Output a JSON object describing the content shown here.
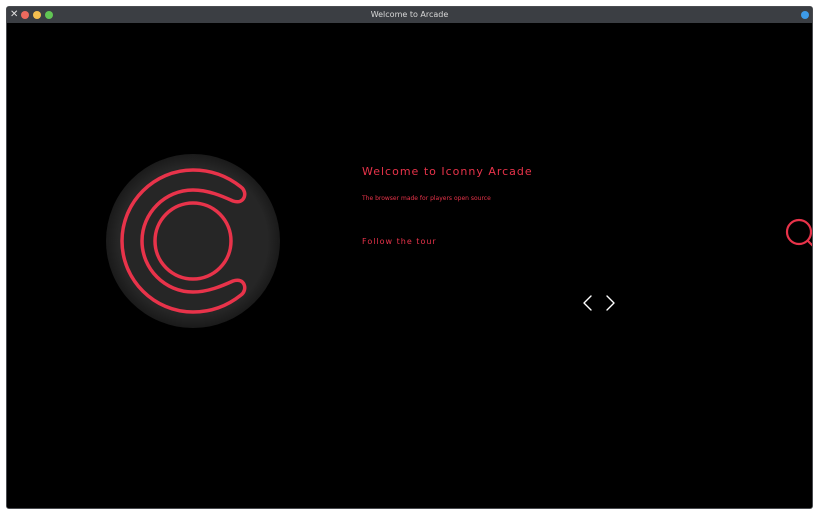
{
  "window": {
    "title": "Welcome to Arcade",
    "close_glyph": "✕"
  },
  "hero": {
    "title": "Welcome to Iconny Arcade",
    "subtitle": "The browser made for players open source",
    "tour_label": "Follow the tour"
  },
  "icons": {
    "logo": "iconny-arcade-logo",
    "prev": "chevron-left-icon",
    "next": "chevron-right-icon",
    "search": "search-icon"
  },
  "colors": {
    "accent": "#e8334a",
    "background": "#000000",
    "titlebar": "#3b3e43",
    "logo_disc": "#262626"
  }
}
